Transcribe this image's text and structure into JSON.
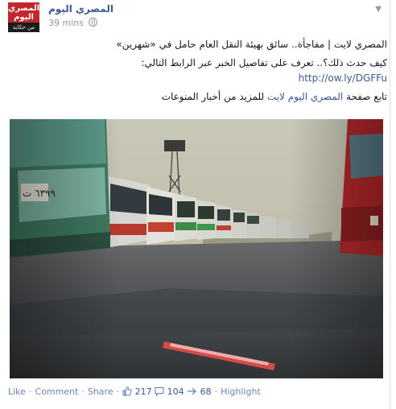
{
  "post": {
    "page_name": "المصري اليوم",
    "timestamp": "39 mins",
    "logo": {
      "line1": "المصري",
      "line2": "اليوم",
      "line3": "من حكاية نعرف"
    },
    "text_lines": [
      "المصري لايت | مفاجأة.. سائق بهيئة النقل العام حامل في «شهرين»",
      "كيف حدث ذلك؟.. تعرف على تفاصيل الخبر عبر الرابط التالي:"
    ],
    "link_url": "http://ow.ly/DGFFu",
    "follow_prefix": "تابع صفحة ",
    "follow_link": "المصري اليوم لايت",
    "follow_suffix": " للمزيد من أخبار المنوعات"
  },
  "actions": {
    "like": "Like",
    "comment": "Comment",
    "share": "Share",
    "likes_count": "217",
    "comments_count": "104",
    "shares_count": "68",
    "highlight": "Highlight"
  },
  "icons": [
    "globe-icon",
    "chevron-down-icon",
    "thumbs-up-icon",
    "comment-bubble-icon",
    "share-arrow-icon"
  ],
  "colors": {
    "brand": "#3b5998",
    "logo_red": "#c1272d",
    "meta_gray": "#9197a3"
  }
}
